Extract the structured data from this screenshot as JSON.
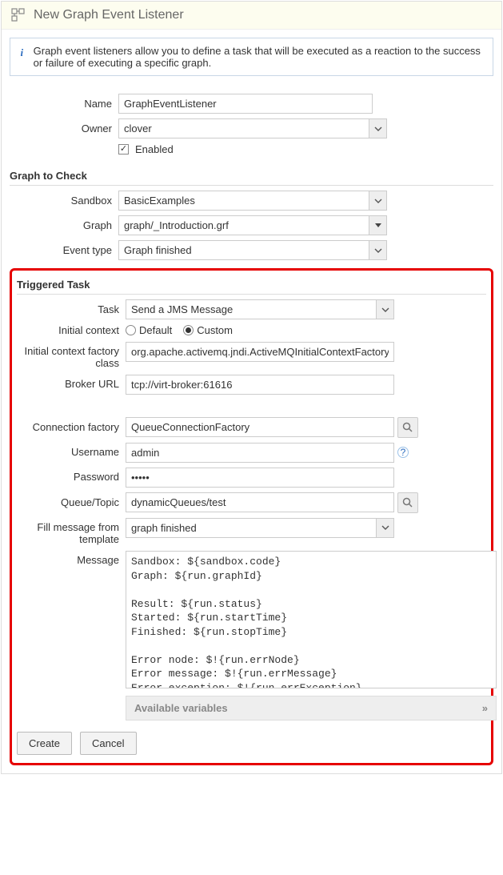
{
  "page_title": "New Graph Event Listener",
  "info_text": "Graph event listeners allow you to define a task that will be executed as a reaction to the success or failure of executing a specific graph.",
  "labels": {
    "name": "Name",
    "owner": "Owner",
    "enabled": "Enabled",
    "sandbox": "Sandbox",
    "graph": "Graph",
    "event_type": "Event type",
    "task": "Task",
    "initial_context": "Initial context",
    "ic_factory": "Initial context factory class",
    "broker_url": "Broker URL",
    "conn_factory": "Connection factory",
    "username": "Username",
    "password": "Password",
    "queue_topic": "Queue/Topic",
    "fill_template": "Fill message from template",
    "message": "Message",
    "avail_vars": "Available variables"
  },
  "sections": {
    "graph_to_check": "Graph to Check",
    "triggered_task": "Triggered Task"
  },
  "values": {
    "name": "GraphEventListener",
    "owner": "clover",
    "enabled": true,
    "sandbox": "BasicExamples",
    "graph": "graph/_Introduction.grf",
    "event_type": "Graph finished",
    "task": "Send a JMS Message",
    "initial_context": "Custom",
    "ic_factory": "org.apache.activemq.jndi.ActiveMQInitialContextFactory",
    "broker_url": "tcp://virt-broker:61616",
    "conn_factory": "QueueConnectionFactory",
    "username": "admin",
    "password": "•••••",
    "queue_topic": "dynamicQueues/test",
    "fill_template": "graph finished",
    "message": "Sandbox: ${sandbox.code}\nGraph: ${run.graphId}\n\nResult: ${run.status}\nStarted: ${run.startTime}\nFinished: ${run.stopTime}\n\nError node: $!{run.errNode}\nError message: $!{run.errMessage}\nError exception: $!{run.errException}\nLog file: $!{run.logLocation}"
  },
  "radio": {
    "default": "Default",
    "custom": "Custom"
  },
  "buttons": {
    "create": "Create",
    "cancel": "Cancel"
  },
  "glyphs": {
    "chevron": "»"
  }
}
